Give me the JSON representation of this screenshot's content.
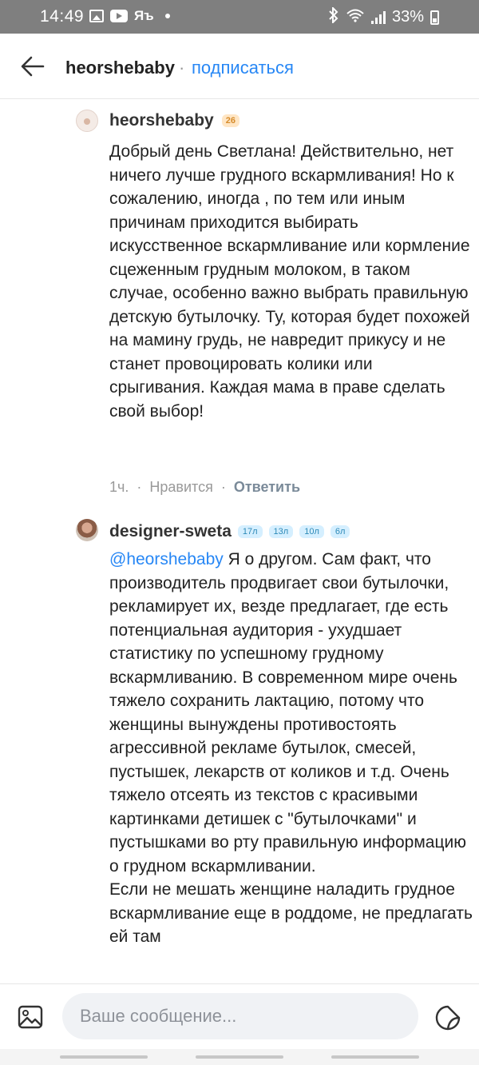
{
  "status_bar": {
    "time": "14:49",
    "battery": "33%",
    "icons": [
      "gallery-icon",
      "youtube-icon",
      "ya-icon",
      "notification-dot-icon",
      "bluetooth-icon",
      "wifi-icon",
      "signal-icon",
      "battery-icon"
    ]
  },
  "header": {
    "title": "heorshebaby",
    "separator": "·",
    "subscribe_label": "подписаться",
    "back_icon": "arrow-left-icon"
  },
  "comments": [
    {
      "author": "heorshebaby",
      "badges": [
        "26"
      ],
      "text": "Добрый день Светлана! Действительно, нет ничего лучше грудного вскармливания! Но к сожалению, иногда , по тем или иным причинам приходится выбирать искусственное вскармливание или кормление сцеженным грудным молоком, в таком случае, особенно важно выбрать правильную детскую бутылочку. Ту, которая будет похожей на мамину грудь, не навредит прикусу и не станет провоцировать колики или срыгивания. Каждая мама в праве сделать свой выбор!",
      "time": "1ч.",
      "like_label": "Нравится",
      "reply_label": "Ответить",
      "dot": "·"
    },
    {
      "author": "designer-sweta",
      "badges": [
        "17л",
        "13л",
        "10л",
        "6л"
      ],
      "mention": "@heorshebaby",
      "text": " Я о другом. Сам факт, что производитель продвигает свои бутылочки, рекламирует их, везде предлагает, где есть потенциальная аудитория - ухудшает статистику по успешному грудному вскармливанию. В современном мире очень тяжело сохранить лактацию, потому что женщины вынуждены противостоять агрессивной рекламе бутылок, смесей, пустышек, лекарств от коликов и т.д. Очень тяжело отсеять из текстов с красивыми картинками детишек с \"бутылочками\" и пустышками во рту правильную информацию о грудном вскармливании.",
      "text2": "Если не мешать женщине наладить грудное вскармливание еще в роддоме, не предлагать ей там"
    }
  ],
  "composer": {
    "placeholder": "Ваше сообщение...",
    "attach_icon": "image-attach-icon",
    "sticker_icon": "sticker-icon"
  },
  "colors": {
    "accent": "#2787f5",
    "status_bar_bg": "#7f7f7f",
    "badge_orange_bg": "#ffe6c5",
    "badge_blue_bg": "#d5efff"
  }
}
